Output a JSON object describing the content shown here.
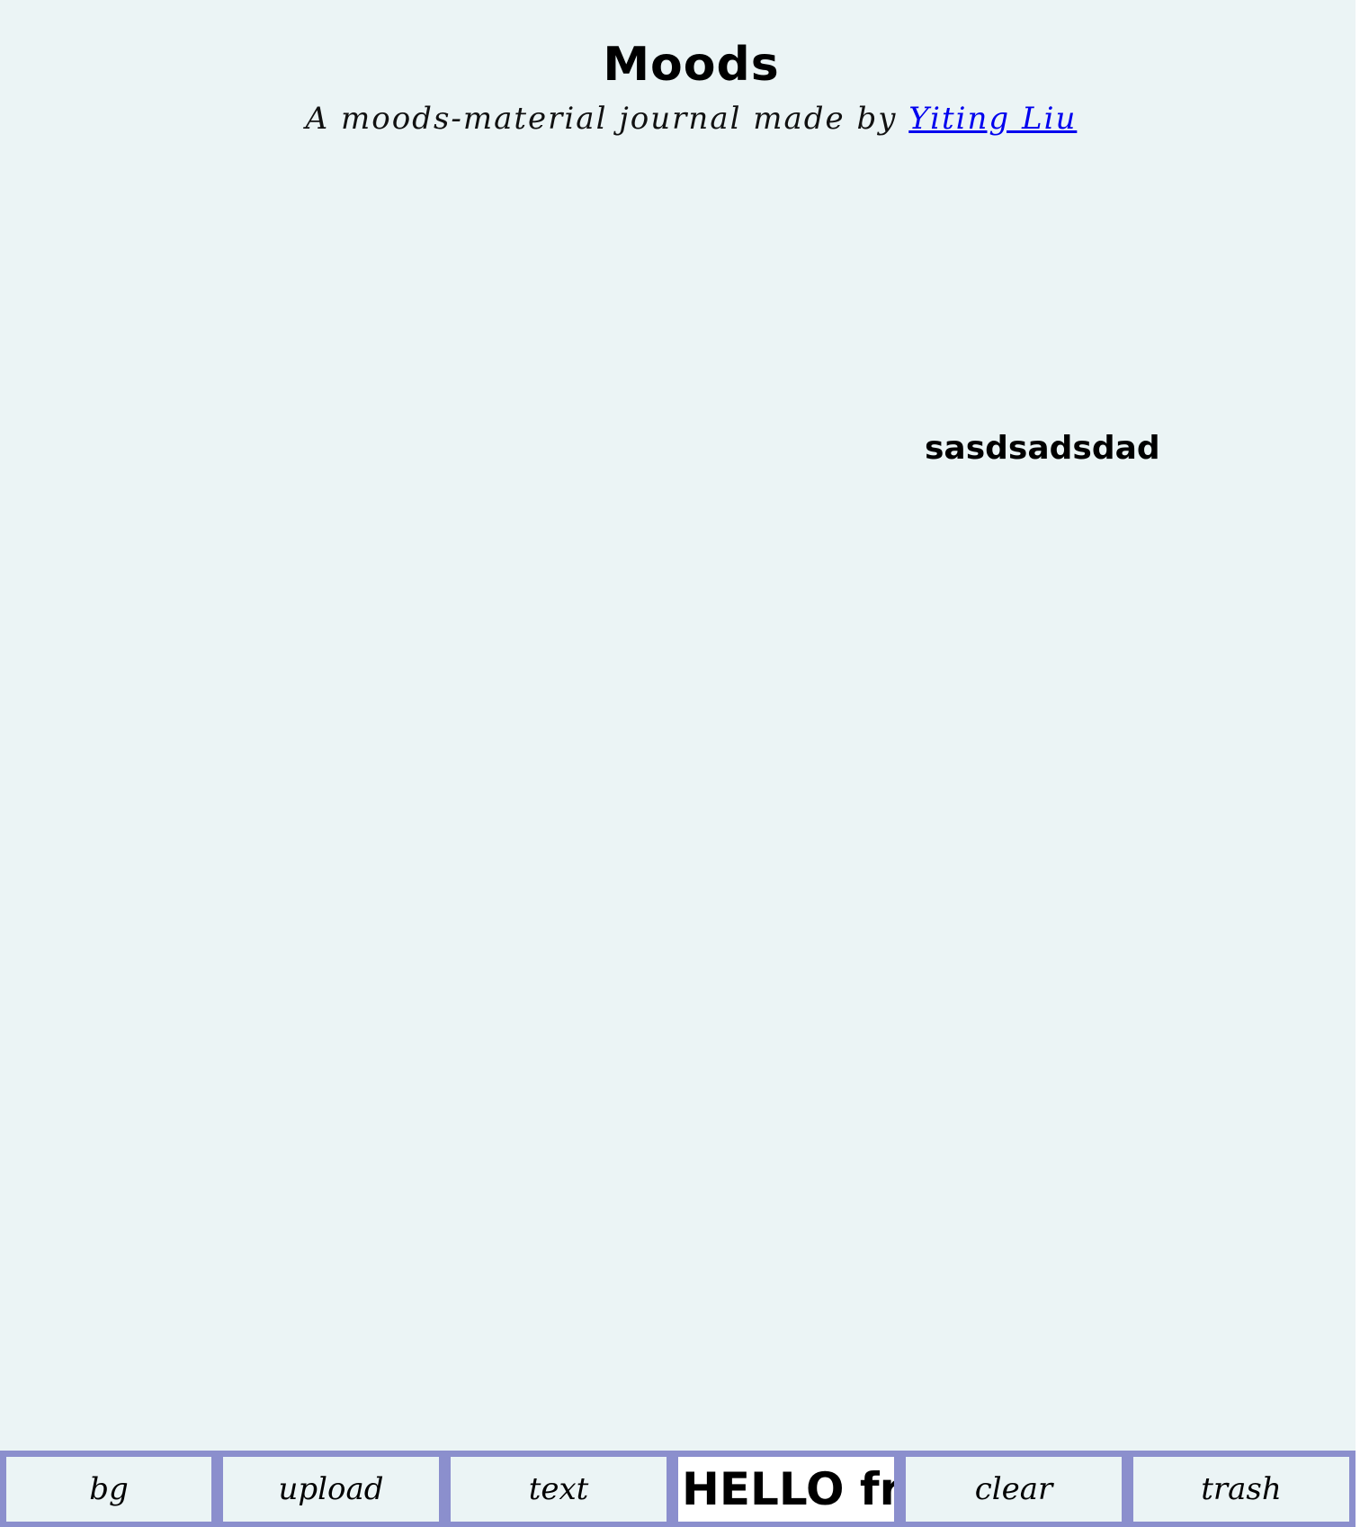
{
  "header": {
    "title": "Moods",
    "subtitle_prefix": "A moods-material journal made by ",
    "author_link": "Yiting Liu"
  },
  "canvas": {
    "text_item": "sasdsadsdad"
  },
  "toolbar": {
    "bg_label": "bg",
    "upload_label": "upload",
    "text_label": "text",
    "font_preview": "HELLO fro",
    "clear_label": "clear",
    "trash_label": "trash"
  },
  "colors": {
    "canvas_background": "#ebf4f5",
    "toolbar_background": "#8b8fcd",
    "link": "#0000ee"
  }
}
